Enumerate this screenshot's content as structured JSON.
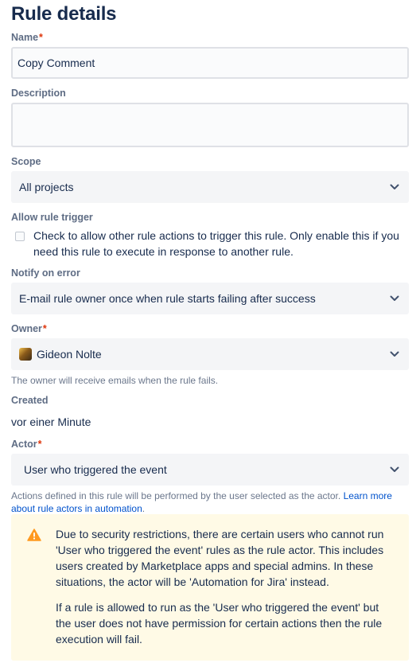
{
  "page_title": "Rule details",
  "name": {
    "label": "Name",
    "required_mark": "*",
    "value": "Copy Comment"
  },
  "description": {
    "label": "Description",
    "value": ""
  },
  "scope": {
    "label": "Scope",
    "value": "All projects"
  },
  "allow_rule_trigger": {
    "label": "Allow rule trigger",
    "checked": false,
    "line1": "Check to allow other rule actions to trigger this rule. Only enable this if you",
    "line2": "need this rule to execute in response to another rule."
  },
  "notify_on_error": {
    "label": "Notify on error",
    "value": "E-mail rule owner once when rule starts failing after success"
  },
  "owner": {
    "label": "Owner",
    "required_mark": "*",
    "value": "Gideon Nolte",
    "helper": "The owner will receive emails when the rule fails."
  },
  "created": {
    "label": "Created",
    "value": "vor einer Minute"
  },
  "actor": {
    "label": "Actor",
    "required_mark": "*",
    "value": "User who triggered the event",
    "helper_text": "Actions defined in this rule will be performed by the user selected as the actor.",
    "link_part1": "Learn more",
    "link_part2": "about rule actors in automation",
    "link_end": "."
  },
  "warning": {
    "icon": "warning-icon",
    "paragraph1_lines": [
      "Due to security restrictions, there are certain users who cannot run",
      "'User who triggered the event' rules as the rule actor. This includes",
      "users created by Marketplace apps and special admins. In these",
      "situations, the actor will be 'Automation for Jira' instead."
    ],
    "paragraph2_lines": [
      "If a rule is allowed to run as the 'User who triggered the event' but",
      "the user does not have permission for certain actions then the rule",
      "execution will fail."
    ]
  },
  "colors": {
    "warning_bg": "#fffae6",
    "warning_icon": "#ff991f",
    "link": "#0052cc",
    "required": "#de350b"
  }
}
